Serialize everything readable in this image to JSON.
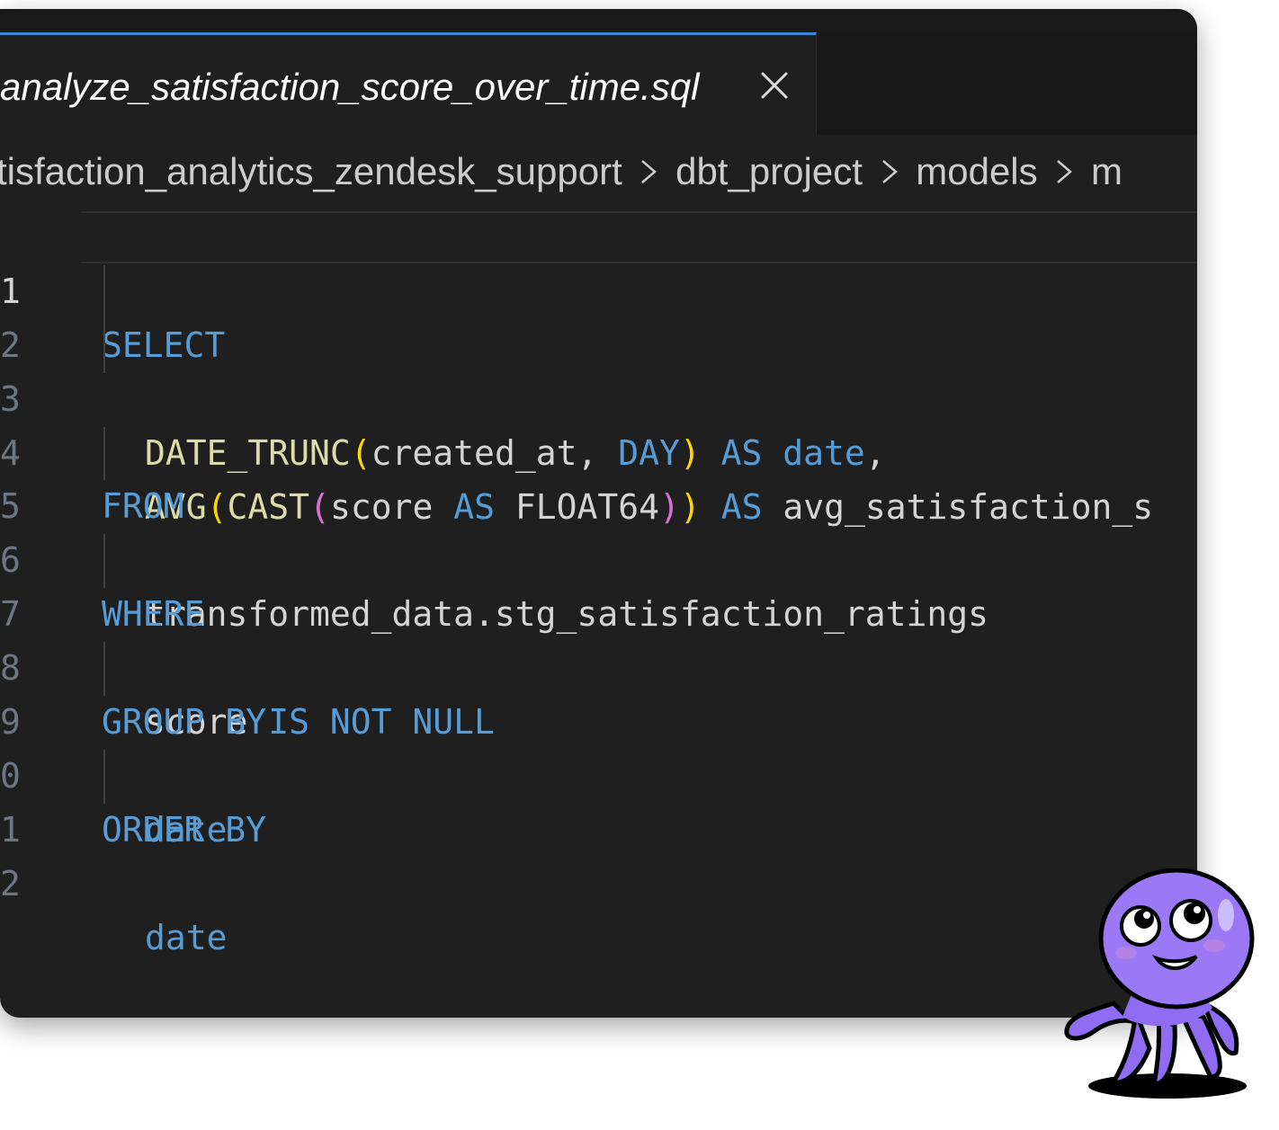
{
  "tab": {
    "title": "analyze_satisfaction_score_over_time.sql",
    "close_icon": "close-icon"
  },
  "breadcrumb": [
    "tisfaction_analytics_zendesk_support",
    "dbt_project",
    "models",
    "m"
  ],
  "line_numbers": [
    "1",
    "2",
    "3",
    "4",
    "5",
    "6",
    "7",
    "8",
    "9",
    "0",
    "1",
    "2"
  ],
  "code": {
    "l1": {
      "kw": "SELECT"
    },
    "l2": {
      "fn": "DATE_TRUNC",
      "open": "(",
      "arg": "created_at, ",
      "kw1": "DAY",
      "close": ")",
      "sp": " ",
      "kw2": "AS",
      "sp2": " ",
      "kw3": "date",
      "tail": ","
    },
    "l3": {
      "fn": "AVG",
      "open1": "(",
      "fn2": "CAST",
      "open2": "(",
      "arg": "score ",
      "kw1": "AS",
      "type": " FLOAT64",
      "close2": ")",
      "close1": ")",
      "sp": " ",
      "kw2": "AS",
      "tail": " avg_satisfaction_s"
    },
    "l4": {
      "kw": "FROM"
    },
    "l5": {
      "id": "transformed_data.stg_satisfaction_ratings"
    },
    "l6": {
      "kw": "WHERE"
    },
    "l7": {
      "id": "score ",
      "kw": "IS NOT NULL"
    },
    "l8": {
      "kw": "GROUP BY"
    },
    "l9": {
      "kw": "date"
    },
    "l10": {
      "kw": "ORDER BY"
    },
    "l11": {
      "kw": "date"
    },
    "l12": {}
  },
  "colors": {
    "editor_bg": "#1f1f1f",
    "keyword": "#569cd6",
    "function": "#dcdcaa",
    "bracket_1": "#ffd700",
    "bracket_2": "#da70d6",
    "active_tab_border": "#3d86d6"
  },
  "mascot": {
    "icon": "octopus-mascot-icon"
  }
}
